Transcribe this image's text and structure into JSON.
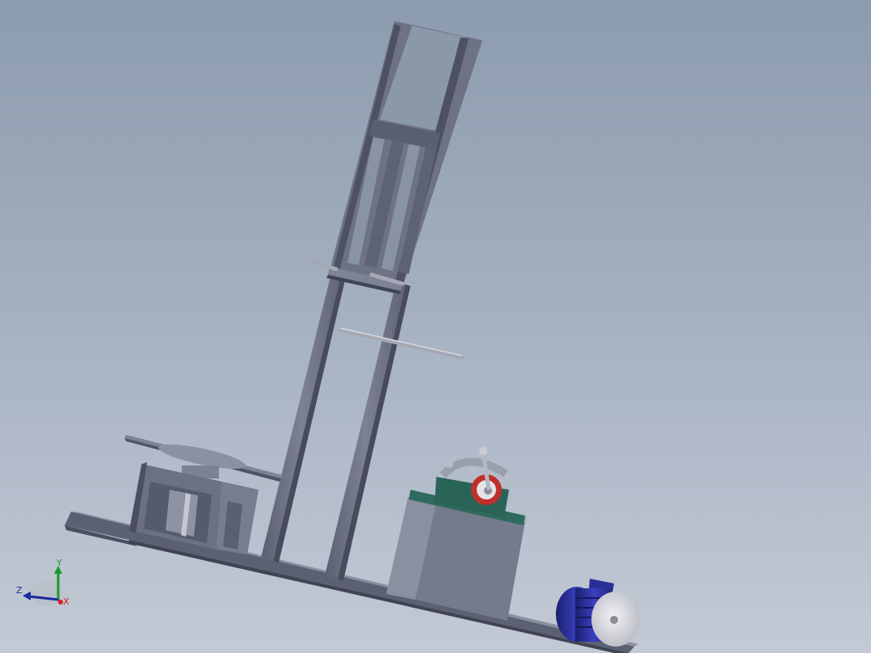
{
  "viewport": {
    "background_top": "#8c9bae",
    "background_bottom": "#c3cad5"
  },
  "model": {
    "colors": {
      "frame": "#6f7486",
      "frame_light": "#8a8fa0",
      "frame_dark": "#4e5263",
      "rod": "#9a9eac",
      "bearing_block": "#2e6b5e",
      "bearing_ring": "#c0302a",
      "motor": "#2a2f9a",
      "pulley": "#d9d9de"
    }
  },
  "triad": {
    "x_label": "X",
    "y_label": "Y",
    "z_label": "Z",
    "x_color": "#d0202a",
    "y_color": "#1a9a2a",
    "z_color": "#1a2aa0"
  }
}
